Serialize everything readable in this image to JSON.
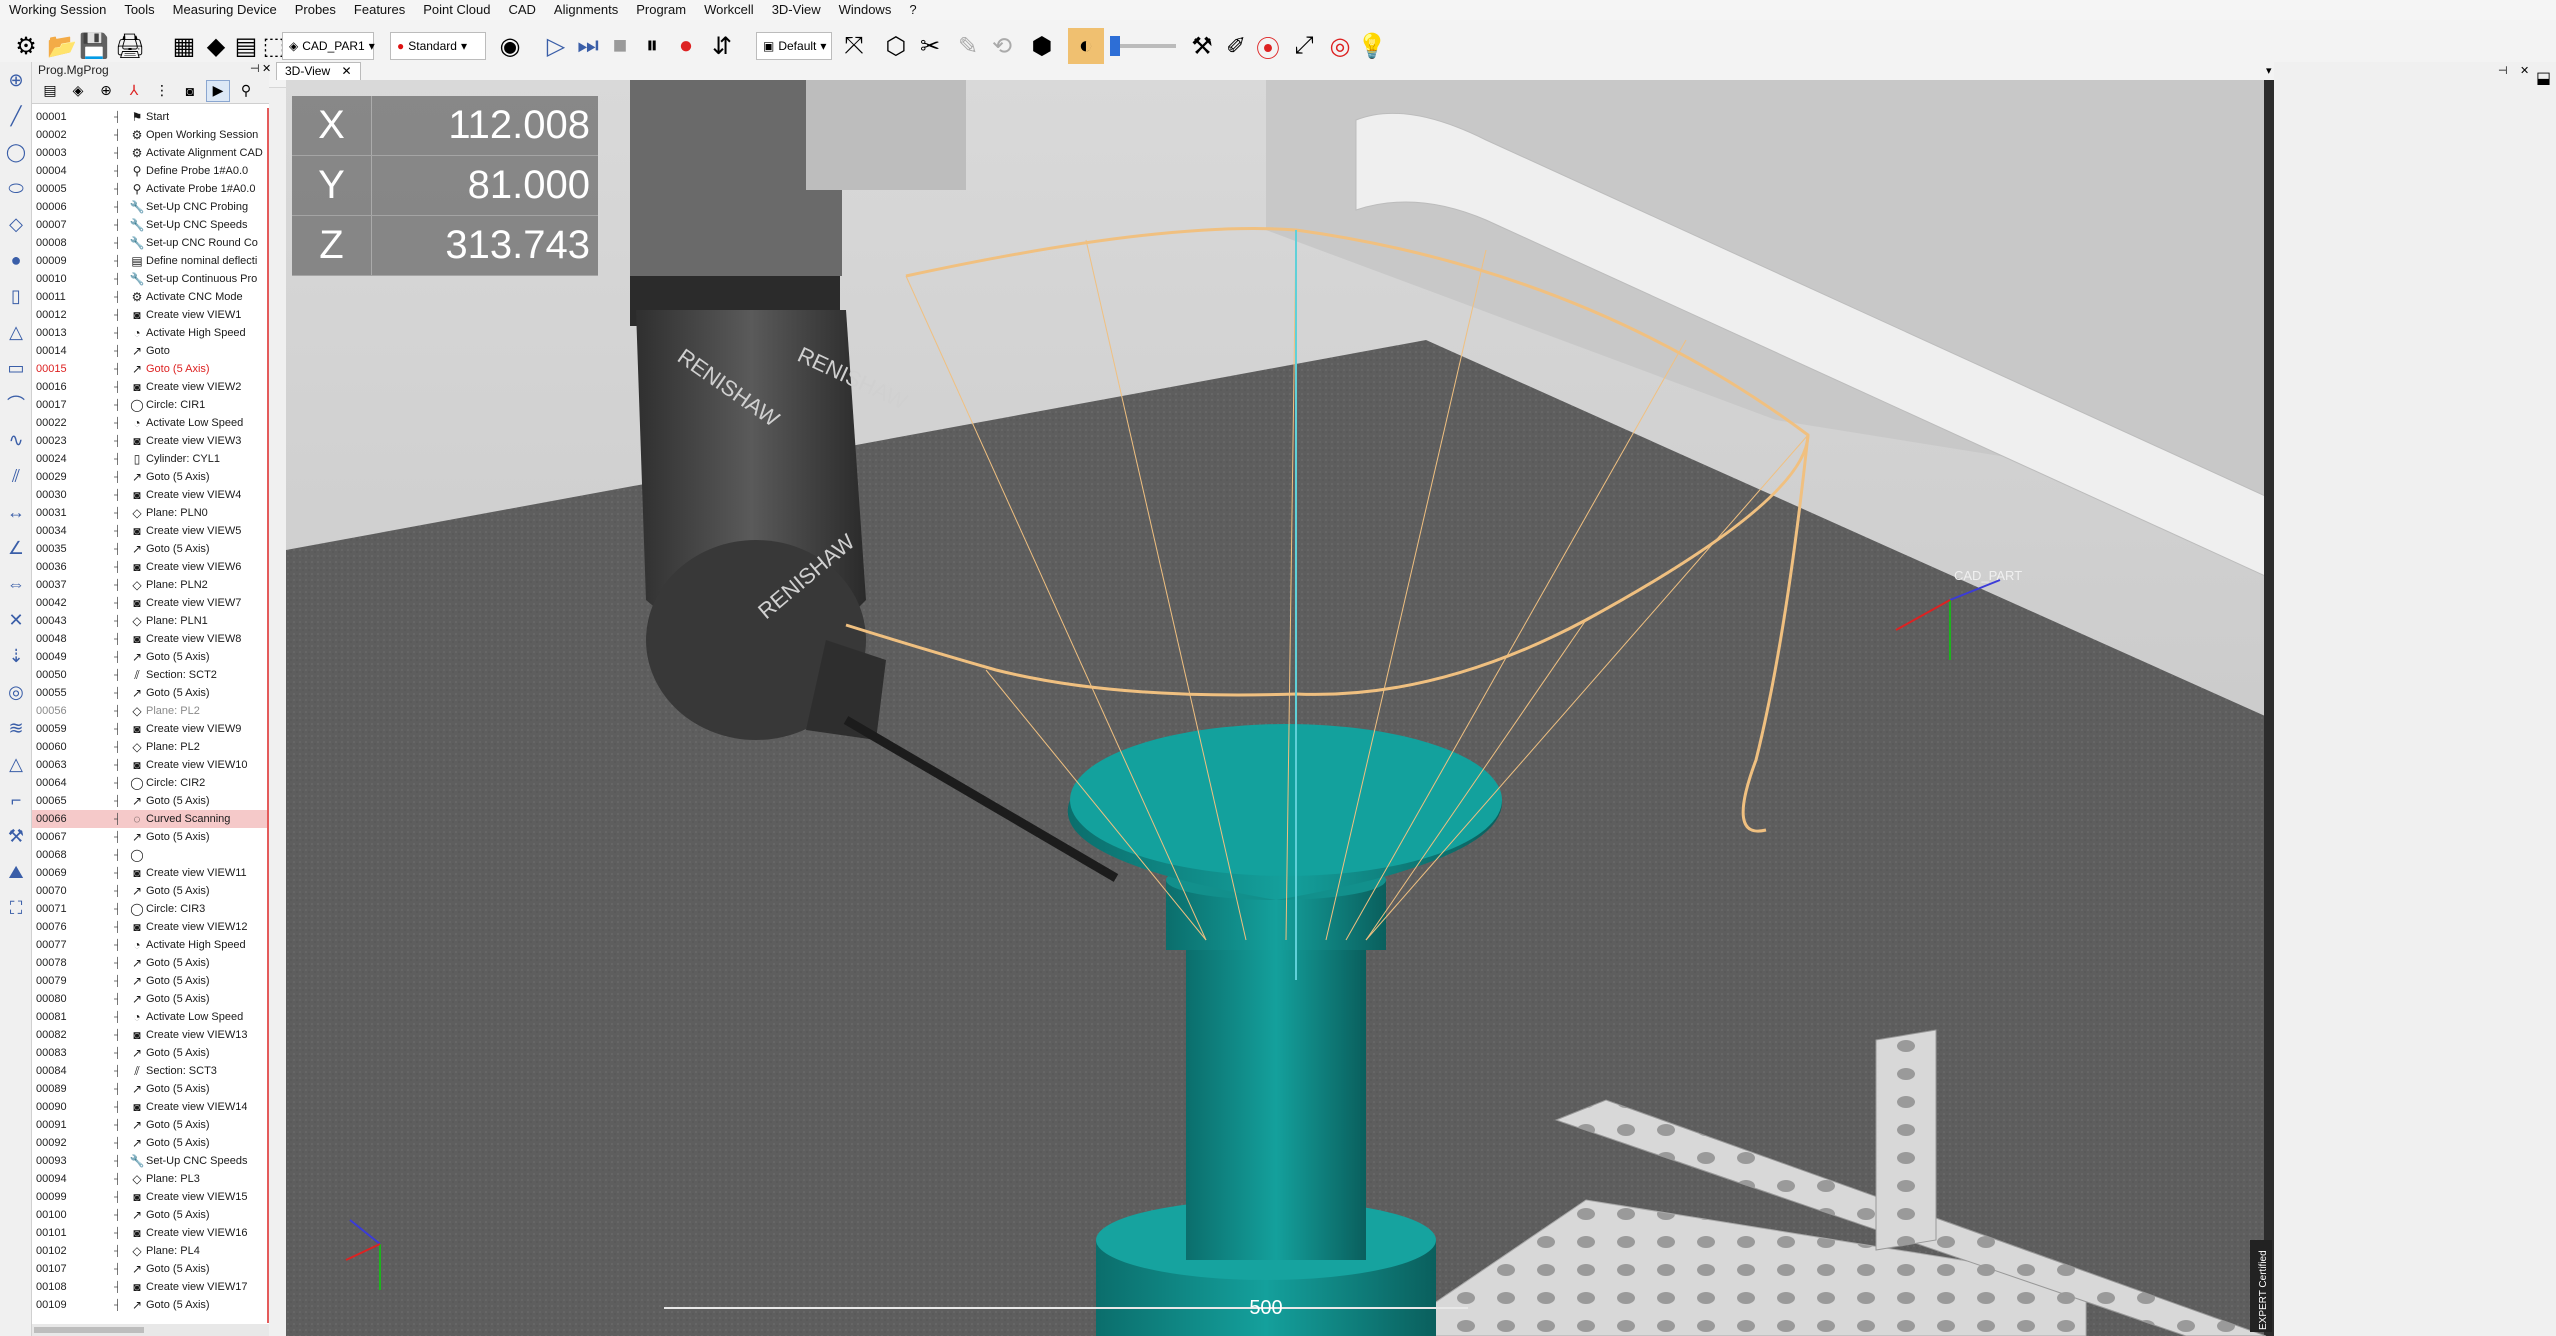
{
  "menu": [
    "Working Session",
    "Tools",
    "Measuring Device",
    "Probes",
    "Features",
    "Point Cloud",
    "CAD",
    "Alignments",
    "Program",
    "Workcell",
    "3D-View",
    "Windows",
    "?"
  ],
  "toolbar": {
    "cad_part_combo": "CAD_PAR1",
    "mode_combo": "Standard",
    "view_combo": "Default"
  },
  "panel": {
    "title": "Prog.MgProg"
  },
  "view": {
    "tab_label": "3D-View",
    "coords": [
      {
        "axis": "X",
        "value": "112.008"
      },
      {
        "axis": "Y",
        "value": "81.000"
      },
      {
        "axis": "Z",
        "value": "313.743"
      }
    ],
    "cad_label": "CAD_PART",
    "scale_label": "500",
    "brand_text": "RENISHAW",
    "expert_badge": "EXPERT Certified"
  },
  "program_rows": [
    {
      "n": "00001",
      "label": "Start",
      "icon": "flag",
      "style": "normal"
    },
    {
      "n": "00002",
      "label": "Open Working Session",
      "icon": "gear",
      "style": "normal"
    },
    {
      "n": "00003",
      "label": "Activate Alignment CAD",
      "icon": "gear",
      "style": "normal"
    },
    {
      "n": "00004",
      "label": "Define Probe 1#A0.0",
      "icon": "probe",
      "style": "normal"
    },
    {
      "n": "00005",
      "label": "Activate Probe 1#A0.0",
      "icon": "probe",
      "style": "normal"
    },
    {
      "n": "00006",
      "label": "Set-Up CNC Probing",
      "icon": "wrench",
      "style": "normal"
    },
    {
      "n": "00007",
      "label": "Set-Up CNC Speeds",
      "icon": "wrench",
      "style": "normal"
    },
    {
      "n": "00008",
      "label": "Set-up CNC Round Co",
      "icon": "wrench",
      "style": "normal"
    },
    {
      "n": "00009",
      "label": "Define nominal deflecti",
      "icon": "doc",
      "style": "normal"
    },
    {
      "n": "00010",
      "label": "Set-up Continuous Pro",
      "icon": "wrench",
      "style": "normal"
    },
    {
      "n": "00011",
      "label": "Activate CNC Mode",
      "icon": "gear",
      "style": "normal"
    },
    {
      "n": "00012",
      "label": "Create view VIEW1",
      "icon": "camera",
      "style": "normal"
    },
    {
      "n": "00013",
      "label": "Activate High Speed",
      "icon": "speed",
      "style": "normal"
    },
    {
      "n": "00014",
      "label": "Goto",
      "icon": "goto",
      "style": "normal"
    },
    {
      "n": "00015",
      "label": "Goto (5 Axis)",
      "icon": "goto",
      "style": "red"
    },
    {
      "n": "00016",
      "label": "Create view VIEW2",
      "icon": "camera",
      "style": "normal"
    },
    {
      "n": "00017",
      "label": "Circle: CIR1",
      "icon": "circle",
      "style": "normal"
    },
    {
      "n": "00022",
      "label": "Activate Low Speed",
      "icon": "speed",
      "style": "normal"
    },
    {
      "n": "00023",
      "label": "Create view VIEW3",
      "icon": "camera",
      "style": "normal"
    },
    {
      "n": "00024",
      "label": "Cylinder: CYL1",
      "icon": "cyl",
      "style": "normal"
    },
    {
      "n": "00029",
      "label": "Goto (5 Axis)",
      "icon": "goto",
      "style": "normal"
    },
    {
      "n": "00030",
      "label": "Create view VIEW4",
      "icon": "camera",
      "style": "normal"
    },
    {
      "n": "00031",
      "label": "Plane: PLN0",
      "icon": "plane",
      "style": "normal"
    },
    {
      "n": "00034",
      "label": "Create view VIEW5",
      "icon": "camera",
      "style": "normal"
    },
    {
      "n": "00035",
      "label": "Goto (5 Axis)",
      "icon": "goto",
      "style": "normal"
    },
    {
      "n": "00036",
      "label": "Create view VIEW6",
      "icon": "camera",
      "style": "normal"
    },
    {
      "n": "00037",
      "label": "Plane: PLN2",
      "icon": "plane",
      "style": "normal"
    },
    {
      "n": "00042",
      "label": "Create view VIEW7",
      "icon": "camera",
      "style": "normal"
    },
    {
      "n": "00043",
      "label": "Plane: PLN1",
      "icon": "plane",
      "style": "normal"
    },
    {
      "n": "00048",
      "label": "Create view VIEW8",
      "icon": "camera",
      "style": "normal"
    },
    {
      "n": "00049",
      "label": "Goto (5 Axis)",
      "icon": "goto",
      "style": "normal"
    },
    {
      "n": "00050",
      "label": "Section: SCT2",
      "icon": "section",
      "style": "normal"
    },
    {
      "n": "00055",
      "label": "Goto (5 Axis)",
      "icon": "goto",
      "style": "normal"
    },
    {
      "n": "00056",
      "label": "Plane: PL2",
      "icon": "plane",
      "style": "grey"
    },
    {
      "n": "00059",
      "label": "Create view VIEW9",
      "icon": "camera",
      "style": "normal"
    },
    {
      "n": "00060",
      "label": "Plane: PL2",
      "icon": "plane",
      "style": "normal"
    },
    {
      "n": "00063",
      "label": "Create view VIEW10",
      "icon": "camera",
      "style": "normal"
    },
    {
      "n": "00064",
      "label": "Circle: CIR2",
      "icon": "circle",
      "style": "normal"
    },
    {
      "n": "00065",
      "label": "Goto (5 Axis)",
      "icon": "goto",
      "style": "normal"
    },
    {
      "n": "00066",
      "label": "Curved Scanning",
      "icon": "scan",
      "style": "sel"
    },
    {
      "n": "00067",
      "label": "Goto (5 Axis)",
      "icon": "goto",
      "style": "normal"
    },
    {
      "n": "00068",
      "label": "",
      "icon": "circle",
      "style": "normal"
    },
    {
      "n": "00069",
      "label": "Create view VIEW11",
      "icon": "camera",
      "style": "normal"
    },
    {
      "n": "00070",
      "label": "Goto (5 Axis)",
      "icon": "goto",
      "style": "normal"
    },
    {
      "n": "00071",
      "label": "Circle: CIR3",
      "icon": "circle",
      "style": "normal"
    },
    {
      "n": "00076",
      "label": "Create view VIEW12",
      "icon": "camera",
      "style": "normal"
    },
    {
      "n": "00077",
      "label": "Activate High Speed",
      "icon": "speed",
      "style": "normal"
    },
    {
      "n": "00078",
      "label": "Goto (5 Axis)",
      "icon": "goto",
      "style": "normal"
    },
    {
      "n": "00079",
      "label": "Goto (5 Axis)",
      "icon": "goto",
      "style": "normal"
    },
    {
      "n": "00080",
      "label": "Goto (5 Axis)",
      "icon": "goto",
      "style": "normal"
    },
    {
      "n": "00081",
      "label": "Activate Low Speed",
      "icon": "speed",
      "style": "normal"
    },
    {
      "n": "00082",
      "label": "Create view VIEW13",
      "icon": "camera",
      "style": "normal"
    },
    {
      "n": "00083",
      "label": "Goto (5 Axis)",
      "icon": "goto",
      "style": "normal"
    },
    {
      "n": "00084",
      "label": "Section: SCT3",
      "icon": "section",
      "style": "normal"
    },
    {
      "n": "00089",
      "label": "Goto (5 Axis)",
      "icon": "goto",
      "style": "normal"
    },
    {
      "n": "00090",
      "label": "Create view VIEW14",
      "icon": "camera",
      "style": "normal"
    },
    {
      "n": "00091",
      "label": "Goto (5 Axis)",
      "icon": "goto",
      "style": "normal"
    },
    {
      "n": "00092",
      "label": "Goto (5 Axis)",
      "icon": "goto",
      "style": "normal"
    },
    {
      "n": "00093",
      "label": "Set-Up CNC Speeds",
      "icon": "wrench",
      "style": "normal"
    },
    {
      "n": "00094",
      "label": "Plane: PL3",
      "icon": "plane",
      "style": "normal"
    },
    {
      "n": "00099",
      "label": "Create view VIEW15",
      "icon": "camera",
      "style": "normal"
    },
    {
      "n": "00100",
      "label": "Goto (5 Axis)",
      "icon": "goto",
      "style": "normal"
    },
    {
      "n": "00101",
      "label": "Create view VIEW16",
      "icon": "camera",
      "style": "normal"
    },
    {
      "n": "00102",
      "label": "Plane: PL4",
      "icon": "plane",
      "style": "normal"
    },
    {
      "n": "00107",
      "label": "Goto (5 Axis)",
      "icon": "goto",
      "style": "normal"
    },
    {
      "n": "00108",
      "label": "Create view VIEW17",
      "icon": "camera",
      "style": "normal"
    },
    {
      "n": "00109",
      "label": "Goto (5 Axis)",
      "icon": "goto",
      "style": "normal"
    }
  ]
}
